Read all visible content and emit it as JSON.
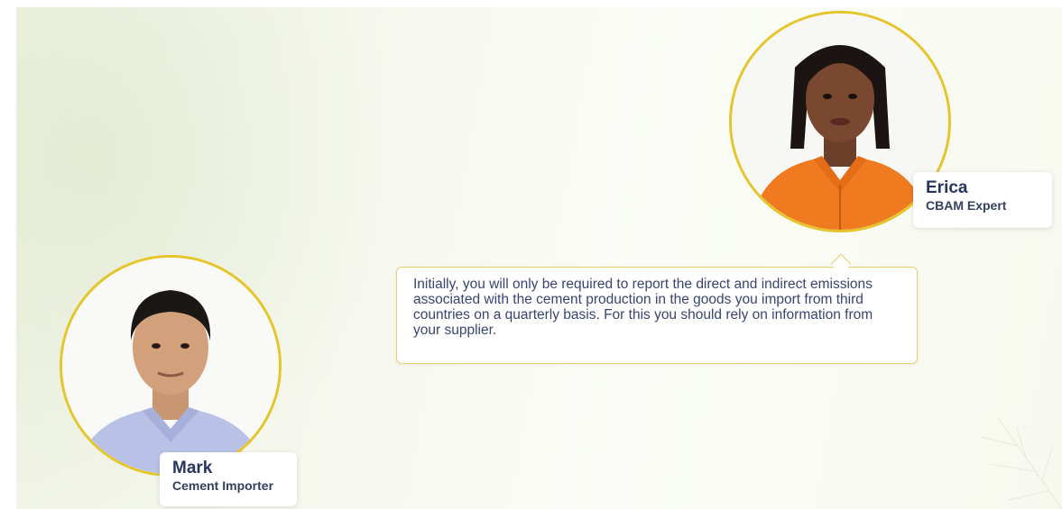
{
  "characters": {
    "erica": {
      "name": "Erica",
      "role": "CBAM Expert"
    },
    "mark": {
      "name": "Mark",
      "role": "Cement Importer"
    }
  },
  "dialogue": {
    "speaker": "Erica",
    "text": "Initially, you will only be required to report the direct and indirect emissions associated with the cement production in the goods you import from third countries on a quarterly basis. For this you should rely on information from your supplier."
  },
  "colors": {
    "avatar_ring": "#e6c52a",
    "name_text": "#27365e",
    "bubble_border": "#e8cd6a",
    "bubble_text": "#3a4470"
  }
}
